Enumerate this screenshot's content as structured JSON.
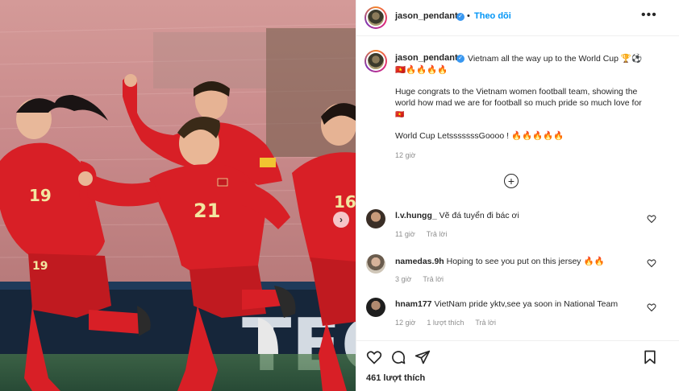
{
  "header": {
    "username": "jason_pendant",
    "follow_label": "Theo dõi",
    "more_label": "•••"
  },
  "caption": {
    "username": "jason_pendant",
    "line1": "Vietnam all the way up to the World Cup 🏆⚽",
    "line1b": "🇻🇳🔥🔥🔥🔥",
    "para": "Huge congrats to the Vietnam women football team, showing the",
    "para2": "world how mad we are for football so much pride so much love for",
    "para3": "🇻🇳",
    "line3": "World Cup LetsssssssGoooo ! 🔥🔥🔥🔥🔥",
    "time": "12 giờ"
  },
  "comments": [
    {
      "username": "l.v.hungg_",
      "text": "Vẽ đá tuyển đi bác ơi",
      "time": "11 giờ",
      "likes": "",
      "reply": "Trả lời"
    },
    {
      "username": "namedas.9h",
      "text": "Hoping to see you put on this jersey 🔥🔥",
      "time": "3 giờ",
      "likes": "",
      "reply": "Trả lời"
    },
    {
      "username": "hnam177",
      "text": "VietNam pride yktv,see ya soon in National Team",
      "time": "12 giờ",
      "likes": "1 lượt thích",
      "reply": "Trả lời"
    }
  ],
  "likes_label": "461 lượt thích",
  "photo": {
    "jersey_numbers": [
      "19",
      "21",
      "16",
      "19"
    ],
    "carousel_next": "›",
    "banner_text": "TEC"
  },
  "icons": {
    "heart": "heart-icon",
    "comment": "comment-icon",
    "share": "paper-plane-icon",
    "save": "bookmark-icon",
    "add": "plus-circle-icon",
    "verified": "verified-badge-icon"
  },
  "colors": {
    "jersey_red": "#d81f26",
    "follow_blue": "#0095f6",
    "verified_blue": "#3897f0"
  }
}
